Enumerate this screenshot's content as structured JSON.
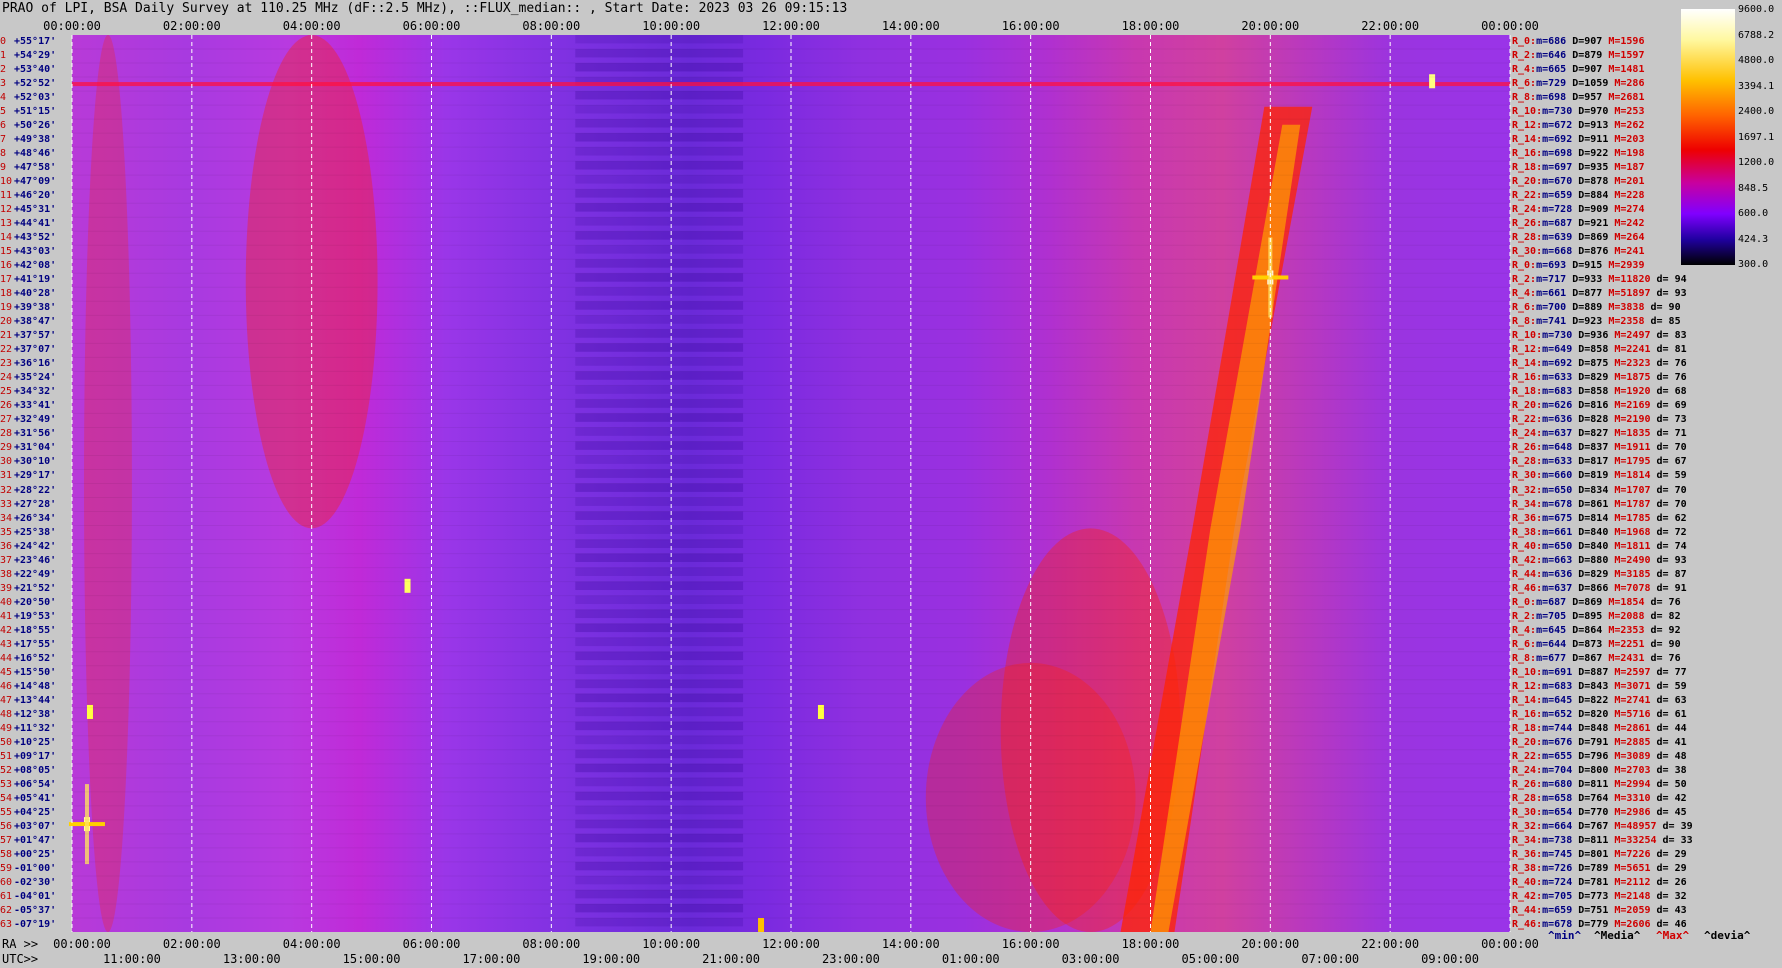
{
  "title": "PRAO of LPI, BSA Daily Survey at 110.25 MHz (dF::2.5 MHz), ::FLUX_median:: , Start Date: 2023 03 26 09:15:13",
  "ra_axis_tag": "RA >>",
  "utc_axis_tag": "UTC>>",
  "top_ticks": [
    "00:00:00",
    "02:00:00",
    "04:00:00",
    "06:00:00",
    "08:00:00",
    "10:00:00",
    "12:00:00",
    "14:00:00",
    "16:00:00",
    "18:00:00",
    "20:00:00",
    "22:00:00",
    "00:00:00"
  ],
  "bottom_ra_ticks": [
    "00:00:00",
    "02:00:00",
    "04:00:00",
    "06:00:00",
    "08:00:00",
    "10:00:00",
    "12:00:00",
    "14:00:00",
    "16:00:00",
    "18:00:00",
    "20:00:00",
    "22:00:00",
    "00:00:00"
  ],
  "bottom_utc_ticks": [
    "11:00:00",
    "13:00:00",
    "15:00:00",
    "17:00:00",
    "19:00:00",
    "21:00:00",
    "23:00:00",
    "01:00:00",
    "03:00:00",
    "05:00:00",
    "07:00:00",
    "09:00:00"
  ],
  "colorbar_labels": [
    "9600.0",
    "6788.2",
    "4800.0",
    "3394.1",
    "2400.0",
    "1697.1",
    "1200.0",
    "848.5",
    "600.0",
    "424.3",
    "300.0"
  ],
  "legend": {
    "min": "^min^",
    "median": "^Media^",
    "max": "^Max^",
    "devia": "^devia^"
  },
  "colors": {
    "background": "#c8c8c8",
    "stat_red": "#d00000",
    "stat_blue": "#000080"
  },
  "chart_data": {
    "type": "heatmap",
    "title": "PRAO of LPI, BSA Daily Survey at 110.25 MHz (dF::2.5 MHz), ::FLUX_median:: , Start Date: 2023 03 26 09:15:13",
    "x_axis": "RA (hours)",
    "x_range": [
      0,
      24
    ],
    "colorbar_range": [
      300,
      9600
    ],
    "colorbar_scale": "log",
    "rows": [
      {
        "i": "0",
        "dec": "+55°17'"
      },
      {
        "i": "1",
        "dec": "+54°29'"
      },
      {
        "i": "2",
        "dec": "+53°40'"
      },
      {
        "i": "3",
        "dec": "+52°52'"
      },
      {
        "i": "4",
        "dec": "+52°03'"
      },
      {
        "i": "5",
        "dec": "+51°15'"
      },
      {
        "i": "6",
        "dec": "+50°26'"
      },
      {
        "i": "7",
        "dec": "+49°38'"
      },
      {
        "i": "8",
        "dec": "+48°46'"
      },
      {
        "i": "9",
        "dec": "+47°58'"
      },
      {
        "i": "10",
        "dec": "+47°09'"
      },
      {
        "i": "11",
        "dec": "+46°20'"
      },
      {
        "i": "12",
        "dec": "+45°31'"
      },
      {
        "i": "13",
        "dec": "+44°41'"
      },
      {
        "i": "14",
        "dec": "+43°52'"
      },
      {
        "i": "15",
        "dec": "+43°03'"
      },
      {
        "i": "16",
        "dec": "+42°08'"
      },
      {
        "i": "17",
        "dec": "+41°19'"
      },
      {
        "i": "18",
        "dec": "+40°28'"
      },
      {
        "i": "19",
        "dec": "+39°38'"
      },
      {
        "i": "20",
        "dec": "+38°47'"
      },
      {
        "i": "21",
        "dec": "+37°57'"
      },
      {
        "i": "22",
        "dec": "+37°07'"
      },
      {
        "i": "23",
        "dec": "+36°16'"
      },
      {
        "i": "24",
        "dec": "+35°24'"
      },
      {
        "i": "25",
        "dec": "+34°32'"
      },
      {
        "i": "26",
        "dec": "+33°41'"
      },
      {
        "i": "27",
        "dec": "+32°49'"
      },
      {
        "i": "28",
        "dec": "+31°56'"
      },
      {
        "i": "29",
        "dec": "+31°04'"
      },
      {
        "i": "30",
        "dec": "+30°10'"
      },
      {
        "i": "31",
        "dec": "+29°17'"
      },
      {
        "i": "32",
        "dec": "+28°22'"
      },
      {
        "i": "33",
        "dec": "+27°28'"
      },
      {
        "i": "34",
        "dec": "+26°34'"
      },
      {
        "i": "35",
        "dec": "+25°38'"
      },
      {
        "i": "36",
        "dec": "+24°42'"
      },
      {
        "i": "37",
        "dec": "+23°46'"
      },
      {
        "i": "38",
        "dec": "+22°49'"
      },
      {
        "i": "39",
        "dec": "+21°52'"
      },
      {
        "i": "40",
        "dec": "+20°50'"
      },
      {
        "i": "41",
        "dec": "+19°53'"
      },
      {
        "i": "42",
        "dec": "+18°55'"
      },
      {
        "i": "43",
        "dec": "+17°55'"
      },
      {
        "i": "44",
        "dec": "+16°52'"
      },
      {
        "i": "45",
        "dec": "+15°50'"
      },
      {
        "i": "46",
        "dec": "+14°48'"
      },
      {
        "i": "47",
        "dec": "+13°44'"
      },
      {
        "i": "48",
        "dec": "+12°38'"
      },
      {
        "i": "49",
        "dec": "+11°32'"
      },
      {
        "i": "50",
        "dec": "+10°25'"
      },
      {
        "i": "51",
        "dec": "+09°17'"
      },
      {
        "i": "52",
        "dec": "+08°05'"
      },
      {
        "i": "53",
        "dec": "+06°54'"
      },
      {
        "i": "54",
        "dec": "+05°41'"
      },
      {
        "i": "55",
        "dec": "+04°25'"
      },
      {
        "i": "56",
        "dec": "+03°07'"
      },
      {
        "i": "57",
        "dec": "+01°47'"
      },
      {
        "i": "58",
        "dec": "+00°25'"
      },
      {
        "i": "59",
        "dec": "-01°00'"
      },
      {
        "i": "60",
        "dec": "-02°30'"
      },
      {
        "i": "61",
        "dec": "-04°01'"
      },
      {
        "i": "62",
        "dec": "-05°37'"
      },
      {
        "i": "63",
        "dec": "-07°19'"
      }
    ],
    "stats": [
      {
        "r": "R_0:",
        "m": "686",
        "D": "907",
        "M": "1596",
        "d": ""
      },
      {
        "r": "R_2:",
        "m": "646",
        "D": "879",
        "M": "1597",
        "d": ""
      },
      {
        "r": "R_4:",
        "m": "665",
        "D": "907",
        "M": "1481",
        "d": ""
      },
      {
        "r": "R_6:",
        "m": "729",
        "D": "1059",
        "M": "286",
        "d": ""
      },
      {
        "r": "R_8:",
        "m": "698",
        "D": "957",
        "M": "2681",
        "d": ""
      },
      {
        "r": "R_10:",
        "m": "730",
        "D": "970",
        "M": "253",
        "d": ""
      },
      {
        "r": "R_12:",
        "m": "672",
        "D": "913",
        "M": "262",
        "d": ""
      },
      {
        "r": "R_14:",
        "m": "692",
        "D": "911",
        "M": "203",
        "d": ""
      },
      {
        "r": "R_16:",
        "m": "698",
        "D": "922",
        "M": "198",
        "d": ""
      },
      {
        "r": "R_18:",
        "m": "697",
        "D": "935",
        "M": "187",
        "d": ""
      },
      {
        "r": "R_20:",
        "m": "670",
        "D": "878",
        "M": "201",
        "d": ""
      },
      {
        "r": "R_22:",
        "m": "659",
        "D": "884",
        "M": "228",
        "d": ""
      },
      {
        "r": "R_24:",
        "m": "728",
        "D": "909",
        "M": "274",
        "d": ""
      },
      {
        "r": "R_26:",
        "m": "687",
        "D": "921",
        "M": "242",
        "d": ""
      },
      {
        "r": "R_28:",
        "m": "639",
        "D": "869",
        "M": "264",
        "d": ""
      },
      {
        "r": "R_30:",
        "m": "668",
        "D": "876",
        "M": "241",
        "d": ""
      },
      {
        "r": "R_0:",
        "m": "693",
        "D": "915",
        "M": "2939",
        "d": ""
      },
      {
        "r": "R_2:",
        "m": "717",
        "D": "933",
        "M": "11820",
        "d": "94"
      },
      {
        "r": "R_4:",
        "m": "661",
        "D": "877",
        "M": "51897",
        "d": "93"
      },
      {
        "r": "R_6:",
        "m": "700",
        "D": "889",
        "M": "3838",
        "d": "90"
      },
      {
        "r": "R_8:",
        "m": "741",
        "D": "923",
        "M": "2358",
        "d": "85"
      },
      {
        "r": "R_10:",
        "m": "730",
        "D": "936",
        "M": "2497",
        "d": "83"
      },
      {
        "r": "R_12:",
        "m": "649",
        "D": "858",
        "M": "2241",
        "d": "81"
      },
      {
        "r": "R_14:",
        "m": "692",
        "D": "875",
        "M": "2323",
        "d": "76"
      },
      {
        "r": "R_16:",
        "m": "633",
        "D": "829",
        "M": "1875",
        "d": "76"
      },
      {
        "r": "R_18:",
        "m": "683",
        "D": "858",
        "M": "1920",
        "d": "68"
      },
      {
        "r": "R_20:",
        "m": "626",
        "D": "816",
        "M": "2169",
        "d": "69"
      },
      {
        "r": "R_22:",
        "m": "636",
        "D": "828",
        "M": "2190",
        "d": "73"
      },
      {
        "r": "R_24:",
        "m": "637",
        "D": "827",
        "M": "1835",
        "d": "71"
      },
      {
        "r": "R_26:",
        "m": "648",
        "D": "837",
        "M": "1911",
        "d": "70"
      },
      {
        "r": "R_28:",
        "m": "633",
        "D": "817",
        "M": "1795",
        "d": "67"
      },
      {
        "r": "R_30:",
        "m": "660",
        "D": "819",
        "M": "1814",
        "d": "59"
      },
      {
        "r": "R_32:",
        "m": "650",
        "D": "834",
        "M": "1707",
        "d": "70"
      },
      {
        "r": "R_34:",
        "m": "678",
        "D": "861",
        "M": "1787",
        "d": "70"
      },
      {
        "r": "R_36:",
        "m": "675",
        "D": "814",
        "M": "1785",
        "d": "62"
      },
      {
        "r": "R_38:",
        "m": "661",
        "D": "840",
        "M": "1968",
        "d": "72"
      },
      {
        "r": "R_40:",
        "m": "650",
        "D": "840",
        "M": "1811",
        "d": "74"
      },
      {
        "r": "R_42:",
        "m": "663",
        "D": "880",
        "M": "2490",
        "d": "93"
      },
      {
        "r": "R_44:",
        "m": "636",
        "D": "829",
        "M": "3185",
        "d": "87"
      },
      {
        "r": "R_46:",
        "m": "637",
        "D": "866",
        "M": "7078",
        "d": "91"
      },
      {
        "r": "R_0:",
        "m": "687",
        "D": "869",
        "M": "1854",
        "d": "76"
      },
      {
        "r": "R_2:",
        "m": "705",
        "D": "895",
        "M": "2088",
        "d": "82"
      },
      {
        "r": "R_4:",
        "m": "645",
        "D": "864",
        "M": "2353",
        "d": "92"
      },
      {
        "r": "R_6:",
        "m": "644",
        "D": "873",
        "M": "2251",
        "d": "90"
      },
      {
        "r": "R_8:",
        "m": "677",
        "D": "867",
        "M": "2431",
        "d": "76"
      },
      {
        "r": "R_10:",
        "m": "691",
        "D": "887",
        "M": "2597",
        "d": "77"
      },
      {
        "r": "R_12:",
        "m": "683",
        "D": "843",
        "M": "3071",
        "d": "59"
      },
      {
        "r": "R_14:",
        "m": "645",
        "D": "822",
        "M": "2741",
        "d": "63"
      },
      {
        "r": "R_16:",
        "m": "652",
        "D": "820",
        "M": "5716",
        "d": "61"
      },
      {
        "r": "R_18:",
        "m": "744",
        "D": "848",
        "M": "2861",
        "d": "44"
      },
      {
        "r": "R_20:",
        "m": "676",
        "D": "791",
        "M": "2885",
        "d": "41"
      },
      {
        "r": "R_22:",
        "m": "655",
        "D": "796",
        "M": "3089",
        "d": "48"
      },
      {
        "r": "R_24:",
        "m": "704",
        "D": "800",
        "M": "2703",
        "d": "38"
      },
      {
        "r": "R_26:",
        "m": "680",
        "D": "811",
        "M": "2994",
        "d": "50"
      },
      {
        "r": "R_28:",
        "m": "658",
        "D": "764",
        "M": "3310",
        "d": "42"
      },
      {
        "r": "R_30:",
        "m": "654",
        "D": "770",
        "M": "2986",
        "d": "45"
      },
      {
        "r": "R_32:",
        "m": "664",
        "D": "767",
        "M": "48957",
        "d": "39"
      },
      {
        "r": "R_34:",
        "m": "738",
        "D": "811",
        "M": "33254",
        "d": "33"
      },
      {
        "r": "R_36:",
        "m": "745",
        "D": "801",
        "M": "7226",
        "d": "29"
      },
      {
        "r": "R_38:",
        "m": "726",
        "D": "789",
        "M": "5651",
        "d": "29"
      },
      {
        "r": "R_40:",
        "m": "724",
        "D": "781",
        "M": "2112",
        "d": "26"
      },
      {
        "r": "R_42:",
        "m": "705",
        "D": "773",
        "M": "2148",
        "d": "32"
      },
      {
        "r": "R_44:",
        "m": "659",
        "D": "751",
        "M": "2059",
        "d": "43"
      },
      {
        "r": "R_46:",
        "m": "678",
        "D": "779",
        "M": "2606",
        "d": "46"
      }
    ]
  }
}
